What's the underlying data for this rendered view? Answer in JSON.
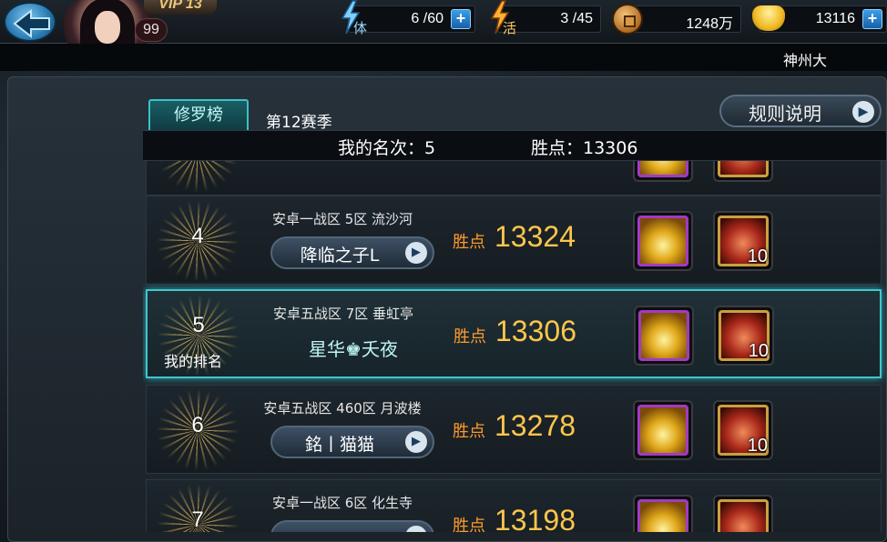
{
  "header": {
    "vip_label": "VIP 13",
    "level": "99",
    "stamina_label": "体",
    "stamina": "6 /60",
    "activity_label": "活",
    "activity": "3 /45",
    "coins": "1248万",
    "ingots": "13116",
    "plus_symbol": "+",
    "player_name_partial": "神州大"
  },
  "leaderboard": {
    "tab_label": "修罗榜",
    "season": "第12赛季",
    "rules_button": "规则说明",
    "my_rank_text": "我的名次：5",
    "my_points_text": "胜点：13306",
    "points_label": "胜点",
    "arrow_symbol": "▶",
    "my_rank_label": "我的排名",
    "rows": [
      {
        "rank": "4",
        "server": "安卓一战区 5区 流沙河",
        "player": "降临之子L",
        "points": "13324",
        "chest_count": "10"
      },
      {
        "rank": "5",
        "server": "安卓五战区 7区 垂虹亭",
        "player": "星华♚夭夜",
        "points": "13306",
        "chest_count": "10"
      },
      {
        "rank": "6",
        "server": "安卓五战区 460区 月波楼",
        "player": "銘丨猫猫",
        "points": "13278",
        "chest_count": "10"
      },
      {
        "rank": "7",
        "server": "安卓一战区 6区 化生寺",
        "player": "",
        "points": "13198",
        "chest_count": ""
      }
    ]
  },
  "colors": {
    "accent_teal": "#3fc6cf",
    "points_gold": "#ffc64a",
    "points_label_orange": "#ff9a2a"
  }
}
